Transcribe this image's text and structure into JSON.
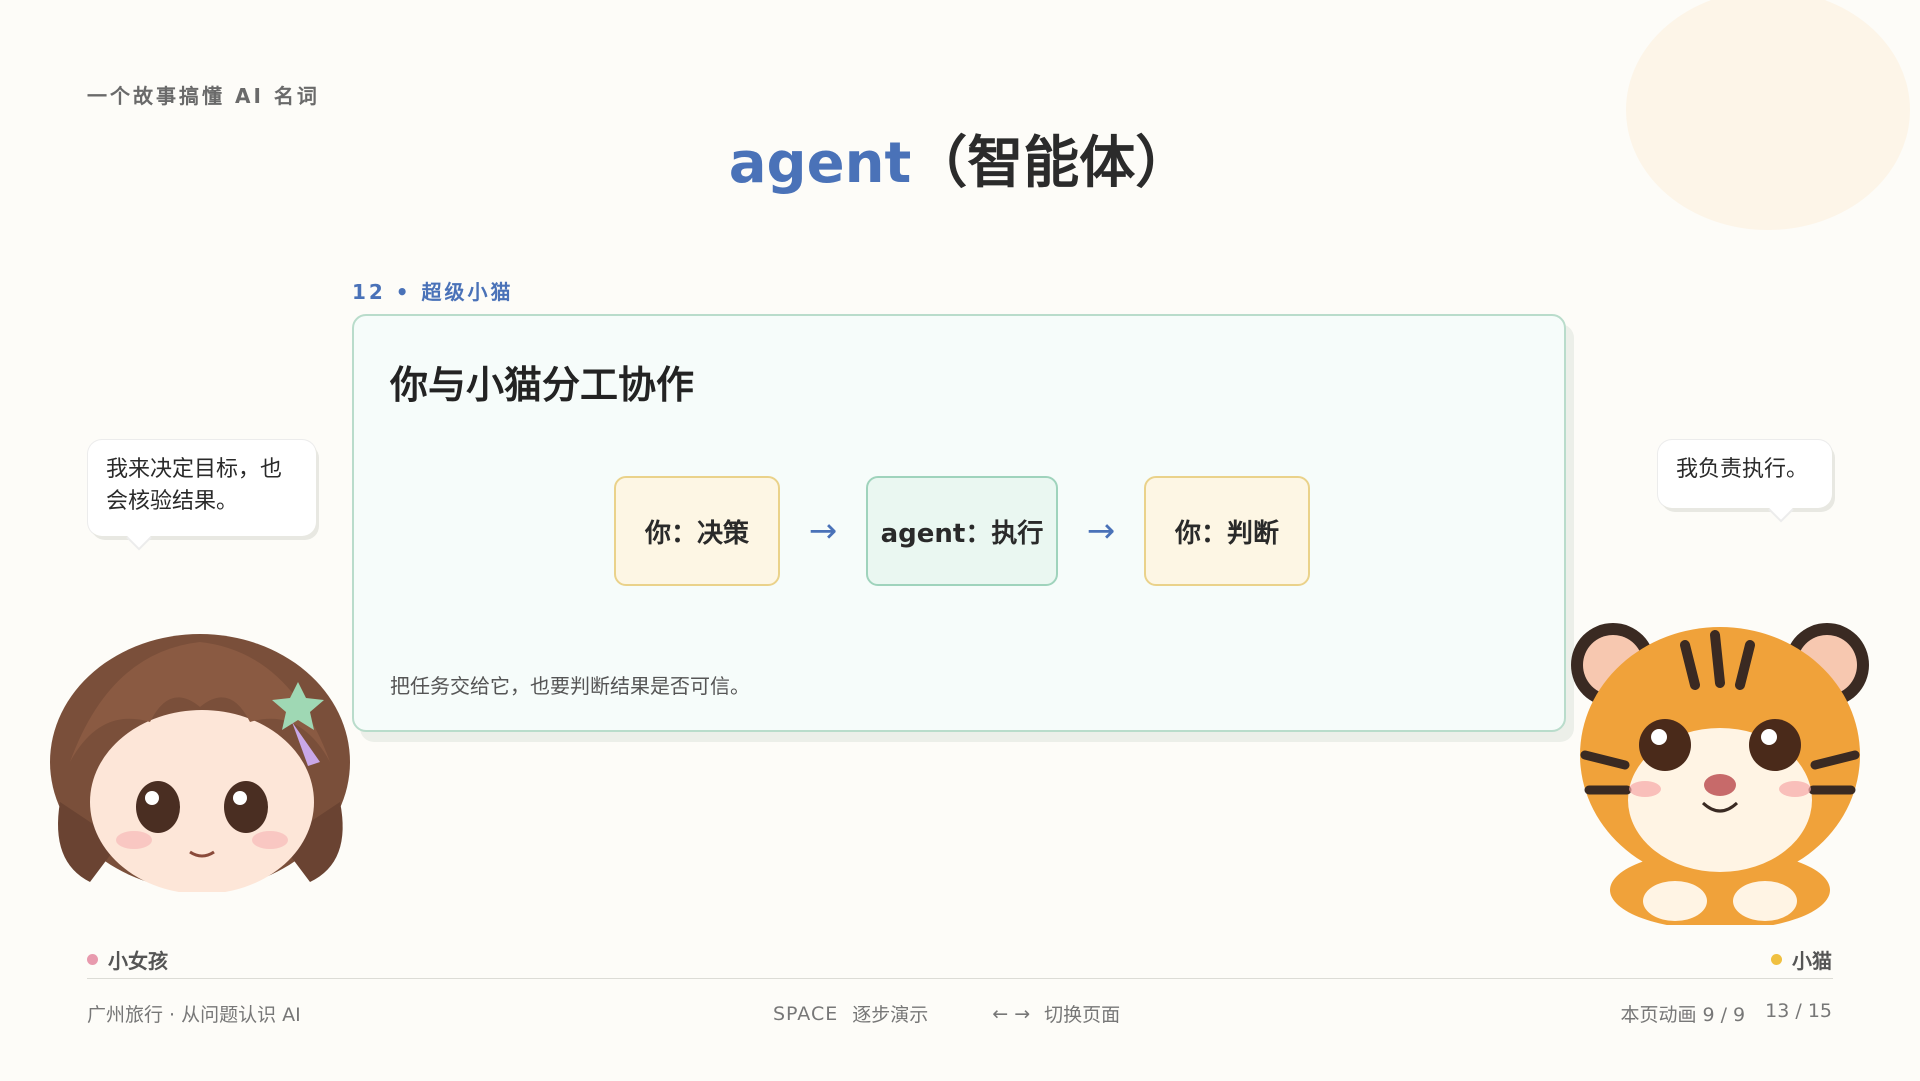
{
  "deck": {
    "series_label": "一个故事搞懂 AI 名词",
    "title_en": "agent",
    "title_zh": "（智能体）"
  },
  "section": {
    "label": "12 • 超级小猫"
  },
  "card": {
    "title": "你与小猫分工协作",
    "steps": [
      {
        "label": "你：决策"
      },
      {
        "label": "agent：执行"
      },
      {
        "label": "你：判断"
      }
    ],
    "arrow": "→",
    "note": "把任务交给它，也要判断结果是否可信。"
  },
  "speech": {
    "girl": "我来决定目标，也会核验结果。",
    "tiger": "我负责执行。"
  },
  "characters": {
    "girl_name": "小女孩",
    "tiger_name": "小猫"
  },
  "footer": {
    "deck_name": "广州旅行 · 从问题认识 AI",
    "key_space": "SPACE",
    "space_action": "逐步演示",
    "key_arrows": "←  →",
    "arrows_action": "切换页面",
    "animation_progress": "本页动画 9 / 9",
    "page_progress": "13 / 15"
  },
  "colors": {
    "accent_blue": "#4a72b8",
    "card_border": "#b9dccb",
    "you_box": "#fdf6e4",
    "agent_box": "#eaf7f1",
    "girl_dot": "#e89aae",
    "tiger_dot": "#f0c040"
  }
}
